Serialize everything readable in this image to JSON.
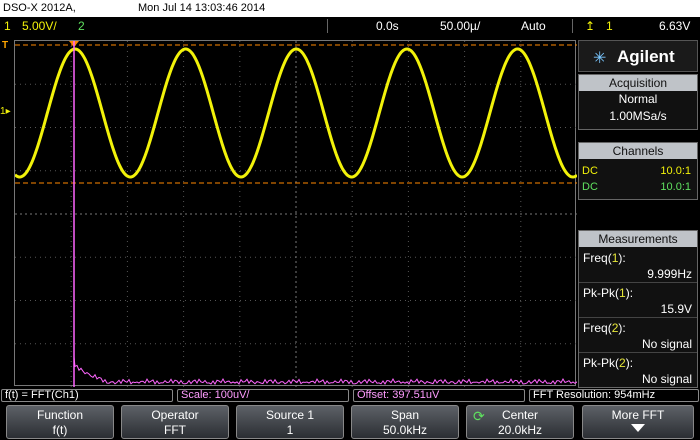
{
  "title_bar": {
    "model": "DSO-X 2012A,",
    "timestamp": "Mon Jul 14 13:03:46 2014"
  },
  "status_bar": {
    "ch1_number": "1",
    "ch1_scale": "5.00V/",
    "ch2_number": "2",
    "horizontal_delay": "0.0s",
    "timebase": "50.00µ/",
    "trigger_mode": "Auto",
    "trigger_slope_icon": "rising-edge-icon",
    "trigger_source": "1",
    "trigger_level": "6.63V"
  },
  "display": {
    "trigger_marker": "T",
    "ch1_marker": "1",
    "fft_marker": "f",
    "colors": {
      "ch1": "#f2f20a",
      "fft": "#ff66ff",
      "ref_line": "#ff8800",
      "grid": "#555555"
    },
    "ch1_waveform": {
      "cycles": 5,
      "note": "sine"
    }
  },
  "brand": {
    "name": "Agilent",
    "logo_icon": "spark-logo-icon"
  },
  "acquisition": {
    "header": "Acquisition",
    "mode": "Normal",
    "rate": "1.00MSa/s"
  },
  "channels": {
    "header": "Channels",
    "rows": [
      {
        "coupling": "DC",
        "probe": "10.0:1",
        "color": "#f2f20a"
      },
      {
        "coupling": "DC",
        "probe": "10.0:1",
        "color": "#5fe05f"
      }
    ]
  },
  "measurements": {
    "header": "Measurements",
    "items": [
      {
        "name": "Freq",
        "src": "1",
        "value": "9.999Hz"
      },
      {
        "name": "Pk-Pk",
        "src": "1",
        "value": "15.9V"
      },
      {
        "name": "Freq",
        "src": "2",
        "value": "No signal"
      },
      {
        "name": "Pk-Pk",
        "src": "2",
        "value": "No signal"
      }
    ]
  },
  "fft_info": {
    "function": "f(t) = FFT(Ch1)",
    "scale": "Scale: 100uV/",
    "offset": "Offset: 397.51uV",
    "resolution": "FFT Resolution: 954mHz"
  },
  "softkeys": [
    {
      "label": "Function",
      "value": "f(t)"
    },
    {
      "label": "Operator",
      "value": "FFT"
    },
    {
      "label": "Source 1",
      "value": "1"
    },
    {
      "label": "Span",
      "value": "50.0kHz"
    },
    {
      "label": "Center",
      "value": "20.0kHz",
      "icon": "knob-icon"
    },
    {
      "label": "More FFT",
      "icon": "down-arrow-icon"
    }
  ]
}
